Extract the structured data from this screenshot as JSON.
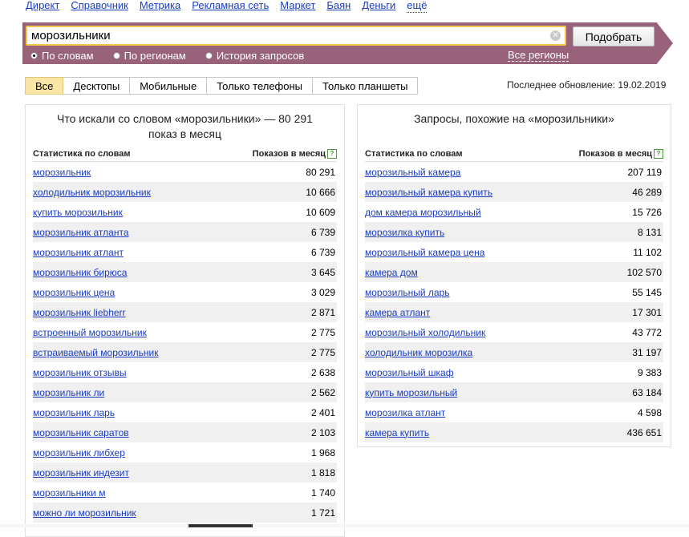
{
  "topnav": [
    "Директ",
    "Справочник",
    "Метрика",
    "Рекламная сеть",
    "Маркет",
    "Баян",
    "Деньги"
  ],
  "topnav_more": "ещё",
  "search": {
    "value": "морозильники",
    "submit_label": "Подобрать"
  },
  "modes": [
    {
      "label": "По словам",
      "checked": true
    },
    {
      "label": "По регионам",
      "checked": false
    },
    {
      "label": "История запросов",
      "checked": false
    }
  ],
  "regions_label": "Все регионы",
  "tabs": [
    {
      "label": "Все",
      "active": true
    },
    {
      "label": "Десктопы",
      "active": false
    },
    {
      "label": "Мобильные",
      "active": false
    },
    {
      "label": "Только телефоны",
      "active": false
    },
    {
      "label": "Только планшеты",
      "active": false
    }
  ],
  "updated": "Последнее обновление: 19.02.2019",
  "left_panel": {
    "title": "Что искали со словом «морозильники» — 80 291 показ в месяц",
    "col_word": "Статистика по словам",
    "col_shows": "Показов в месяц",
    "rows": [
      {
        "word": "морозильник",
        "shows": "80 291"
      },
      {
        "word": "холодильник морозильник",
        "shows": "10 666"
      },
      {
        "word": "купить морозильник",
        "shows": "10 609"
      },
      {
        "word": "морозильник атланта",
        "shows": "6 739"
      },
      {
        "word": "морозильник атлант",
        "shows": "6 739"
      },
      {
        "word": "морозильник бирюса",
        "shows": "3 645"
      },
      {
        "word": "морозильник цена",
        "shows": "3 029"
      },
      {
        "word": "морозильник liebherr",
        "shows": "2 871"
      },
      {
        "word": "встроенный морозильник",
        "shows": "2 775"
      },
      {
        "word": "встраиваемый морозильник",
        "shows": "2 775"
      },
      {
        "word": "морозильник отзывы",
        "shows": "2 638"
      },
      {
        "word": "морозильник ли",
        "shows": "2 562"
      },
      {
        "word": "морозильник ларь",
        "shows": "2 401"
      },
      {
        "word": "морозильник саратов",
        "shows": "2 103"
      },
      {
        "word": "морозильник либхер",
        "shows": "1 968"
      },
      {
        "word": "морозильник индезит",
        "shows": "1 818"
      },
      {
        "word": "морозильники м",
        "shows": "1 740"
      },
      {
        "word": "можно ли морозильник",
        "shows": "1 721"
      }
    ]
  },
  "right_panel": {
    "title": "Запросы, похожие на «морозильники»",
    "col_word": "Статистика по словам",
    "col_shows": "Показов в месяц",
    "rows": [
      {
        "word": "морозильный камера",
        "shows": "207 119"
      },
      {
        "word": "морозильный камера купить",
        "shows": "46 289"
      },
      {
        "word": "дом камера морозильный",
        "shows": "15 726"
      },
      {
        "word": "морозилка купить",
        "shows": "8 131"
      },
      {
        "word": "морозильный камера цена",
        "shows": "11 102"
      },
      {
        "word": "камера дом",
        "shows": "102 570"
      },
      {
        "word": "морозильный ларь",
        "shows": "55 145"
      },
      {
        "word": "камера атлант",
        "shows": "17 301"
      },
      {
        "word": "морозильный холодильник",
        "shows": "43 772"
      },
      {
        "word": "холодильник морозилка",
        "shows": "31 197"
      },
      {
        "word": "морозильный шкаф",
        "shows": "9 383"
      },
      {
        "word": "купить морозильный",
        "shows": "63 184"
      },
      {
        "word": "морозилка атлант",
        "shows": "4 598"
      },
      {
        "word": "камера купить",
        "shows": "436 651"
      }
    ]
  }
}
